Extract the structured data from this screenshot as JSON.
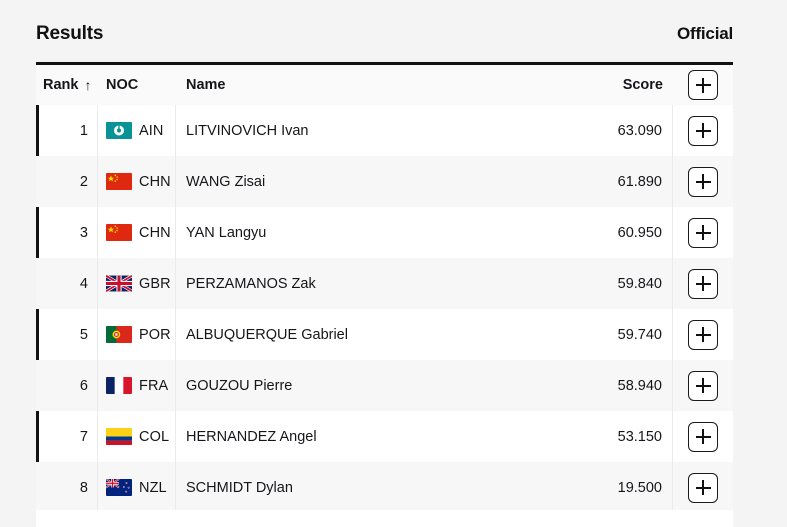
{
  "header": {
    "title": "Results",
    "status": "Official"
  },
  "table": {
    "columns": {
      "rank": "Rank",
      "sort_arrow": "↑",
      "noc": "NOC",
      "name": "Name",
      "score": "Score",
      "add_label": "+"
    },
    "add_button_icon": "plus-icon",
    "rows": [
      {
        "rank": "1",
        "noc": "AIN",
        "flag": "ain-flag",
        "name": "LITVINOVICH Ivan",
        "score": "63.090"
      },
      {
        "rank": "2",
        "noc": "CHN",
        "flag": "chn-flag",
        "name": "WANG Zisai",
        "score": "61.890"
      },
      {
        "rank": "3",
        "noc": "CHN",
        "flag": "chn-flag",
        "name": "YAN Langyu",
        "score": "60.950"
      },
      {
        "rank": "4",
        "noc": "GBR",
        "flag": "gbr-flag",
        "name": "PERZAMANOS Zak",
        "score": "59.840"
      },
      {
        "rank": "5",
        "noc": "POR",
        "flag": "por-flag",
        "name": "ALBUQUERQUE Gabriel",
        "score": "59.740"
      },
      {
        "rank": "6",
        "noc": "FRA",
        "flag": "fra-flag",
        "name": "GOUZOU Pierre",
        "score": "58.940"
      },
      {
        "rank": "7",
        "noc": "COL",
        "flag": "col-flag",
        "name": "HERNANDEZ Angel",
        "score": "53.150"
      },
      {
        "rank": "8",
        "noc": "NZL",
        "flag": "nzl-flag",
        "name": "SCHMIDT Dylan",
        "score": "19.500"
      }
    ]
  },
  "colors": {
    "page_background": "#f4f4f4",
    "row_background": "#ffffff",
    "row_alt_background": "#f7f7f7",
    "rank_marker": "#121212",
    "text": "#16161a"
  }
}
